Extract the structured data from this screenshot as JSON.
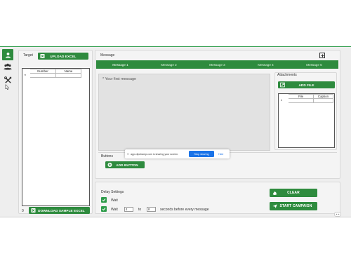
{
  "target": {
    "label": "Target",
    "upload_label": "UPLOAD EXCEL",
    "columns": [
      "Number",
      "Name"
    ],
    "row_marker": "*",
    "count": "0",
    "download_label": "DOWNLOAD SAMPLE EXCEL"
  },
  "message": {
    "label": "Message",
    "tabs": [
      "Message 1",
      "Message 2",
      "Message 3",
      "Message 4",
      "Message 5"
    ],
    "placeholder": "* Your first message"
  },
  "attachments": {
    "label": "Attachments",
    "add_label": "ADD FILE",
    "columns": [
      "File",
      "Caption"
    ],
    "row_marker": "*"
  },
  "buttons": {
    "label": "Buttons",
    "add_label": "ADD BUTTON"
  },
  "delay": {
    "label": "Delay Settings",
    "row1_text": "Wait",
    "row2_text": "Wait",
    "min_value": "4",
    "to_text": "to",
    "max_value": "8",
    "suffix": "seconds before every message"
  },
  "actions": {
    "clear_label": "CLEAR",
    "start_label": "START CAMPAIGN"
  },
  "share_bar": {
    "text": "app.clipchamp.com is sharing your screen.",
    "stop_label": "Stop sharing",
    "hide_label": "Hide"
  },
  "colors": {
    "accent": "#2e8b3e",
    "accent_light": "#2e9c4a",
    "share_blue": "#1a73e8"
  }
}
